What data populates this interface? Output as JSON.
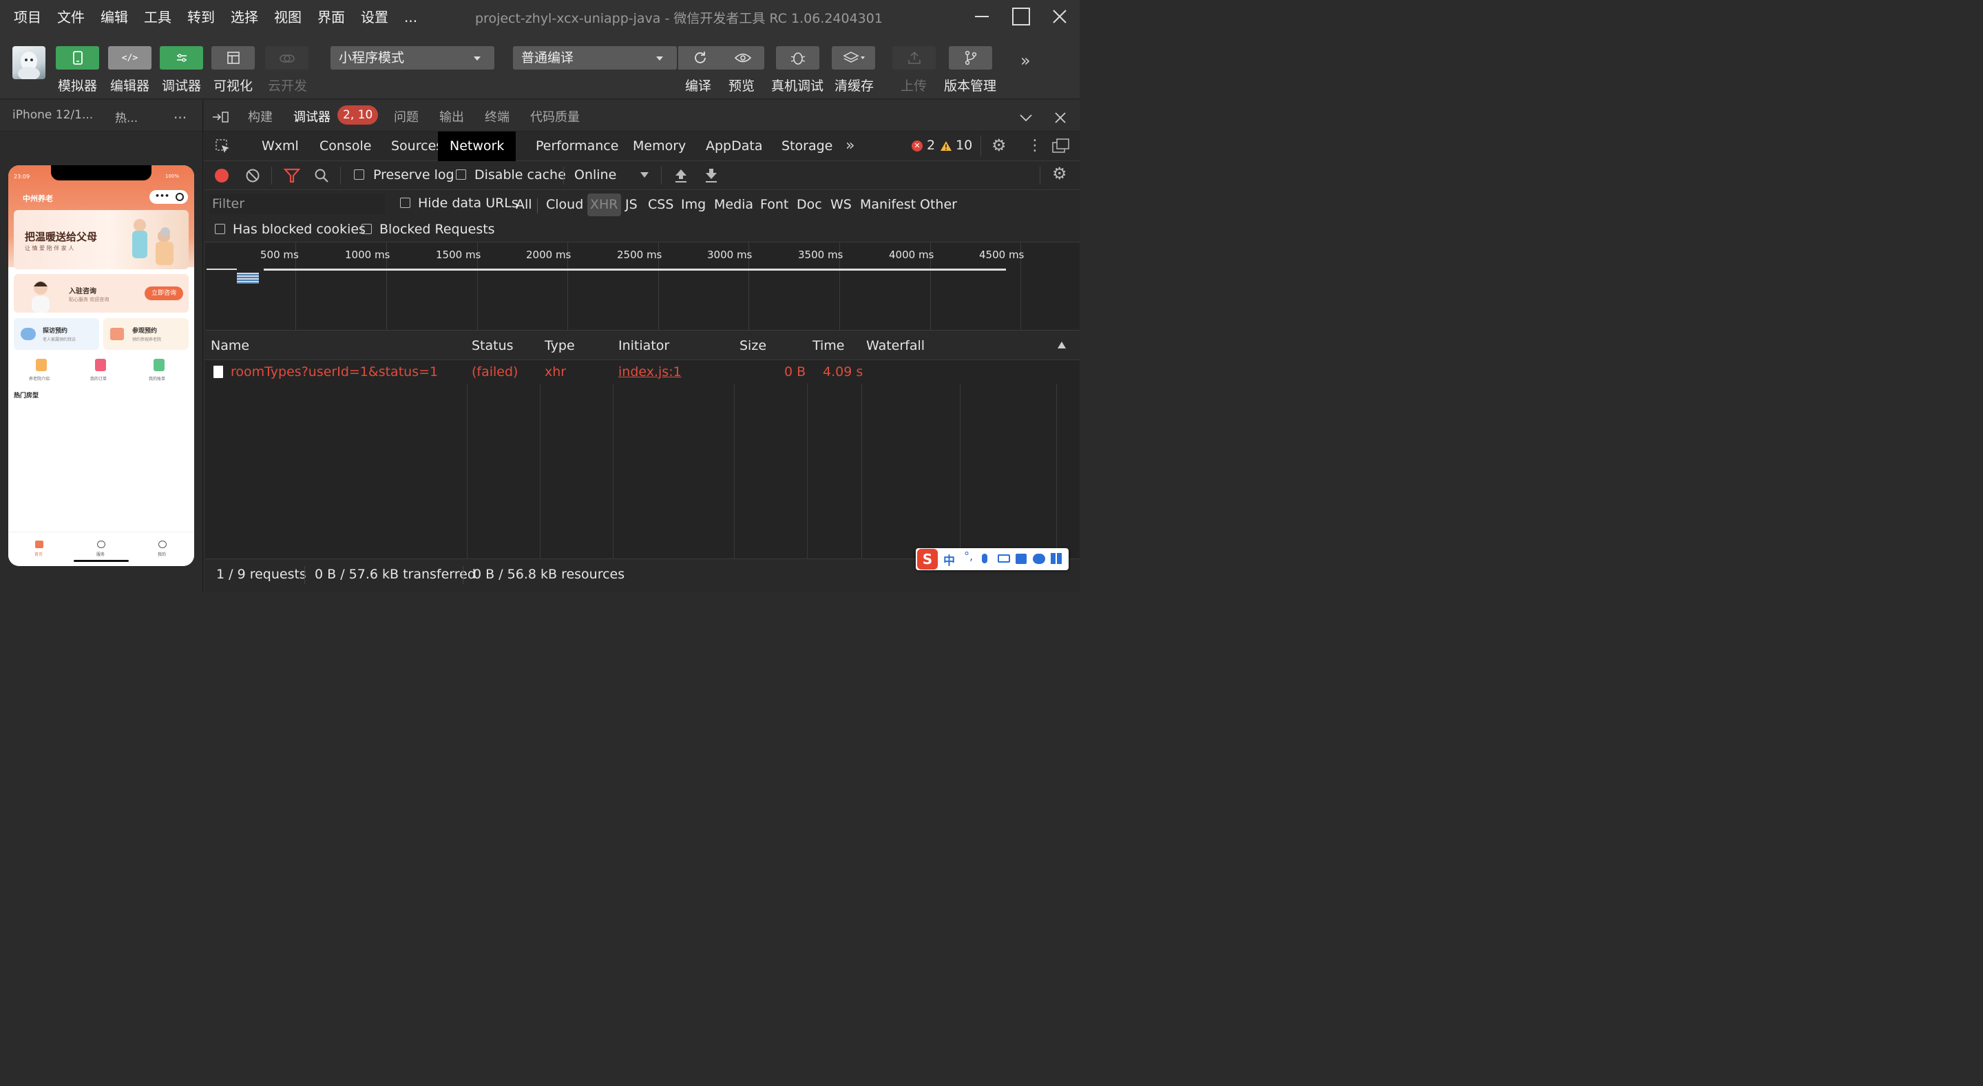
{
  "menu": [
    "项目",
    "文件",
    "编辑",
    "工具",
    "转到",
    "选择",
    "视图",
    "界面",
    "设置",
    "..."
  ],
  "app_title": "project-zhyl-xcx-uniapp-java - 微信开发者工具 RC 1.06.2404301",
  "toolbar": {
    "simulator": "模拟器",
    "editor": "编辑器",
    "debugger": "调试器",
    "visual": "可视化",
    "cloud": "云开发",
    "mode_select": "小程序模式",
    "compile_select": "普通编译",
    "compile": "编译",
    "preview": "预览",
    "real_debug": "真机调试",
    "clear_cache": "清缓存",
    "upload": "上传",
    "version": "版本管理"
  },
  "left_tabs": {
    "device": "iPhone 12/1...",
    "hot": "热...",
    "more": "..."
  },
  "phone": {
    "time": "23:09",
    "battery": "100%",
    "app_name": "中州养老",
    "banner_title": "把温暖送给父母",
    "banner_sub": "让 情 爱 陪 伴 家 人",
    "consult_title": "入驻咨询",
    "consult_sub": "贴心服务 欢迎咨询",
    "consult_btn": "立即咨询",
    "visit_title": "探访预约",
    "visit_sub": "老人家属预约拜访",
    "tour_title": "参观预约",
    "tour_sub": "预约参观养老院",
    "icons": [
      "养老院介绍",
      "我的订单",
      "我的账单"
    ],
    "section": "热门房型",
    "nav": [
      "首页",
      "服务",
      "我的"
    ]
  },
  "devtools_tabs": {
    "build": "构建",
    "debugger": "调试器",
    "badge": "2, 10",
    "issues": "问题",
    "output": "输出",
    "terminal": "终端",
    "quality": "代码质量"
  },
  "panel_tabs": [
    "Wxml",
    "Console",
    "Sources",
    "Network",
    "Performance",
    "Memory",
    "AppData",
    "Storage"
  ],
  "errors": "2",
  "warnings": "10",
  "net_toolbar": {
    "preserve_log": "Preserve log",
    "disable_cache": "Disable cache",
    "throttle": "Online"
  },
  "filter": {
    "placeholder": "Filter",
    "hide_data_urls": "Hide data URLs",
    "types": [
      "All",
      "Cloud",
      "XHR",
      "JS",
      "CSS",
      "Img",
      "Media",
      "Font",
      "Doc",
      "WS",
      "Manifest",
      "Other"
    ],
    "has_blocked_cookies": "Has blocked cookies",
    "blocked_requests": "Blocked Requests"
  },
  "overview_ticks": [
    "500 ms",
    "1000 ms",
    "1500 ms",
    "2000 ms",
    "2500 ms",
    "3000 ms",
    "3500 ms",
    "4000 ms",
    "4500 ms"
  ],
  "table": {
    "headers": [
      "Name",
      "Status",
      "Type",
      "Initiator",
      "Size",
      "Time",
      "Waterfall"
    ],
    "rows": [
      {
        "name": "roomTypes?userId=1&status=1",
        "status": "(failed)",
        "type": "xhr",
        "initiator": "index.js:1",
        "size": "0 B",
        "time": "4.09 s"
      }
    ]
  },
  "status": {
    "requests": "1 / 9 requests",
    "transferred": "0 B / 57.6 kB transferred",
    "resources": "0 B / 56.8 kB resources"
  },
  "ime_text": "中",
  "colors": {
    "accent_green": "#3fa35b",
    "error_red": "#e24c3c",
    "phone_orange": "#ee7a52"
  }
}
